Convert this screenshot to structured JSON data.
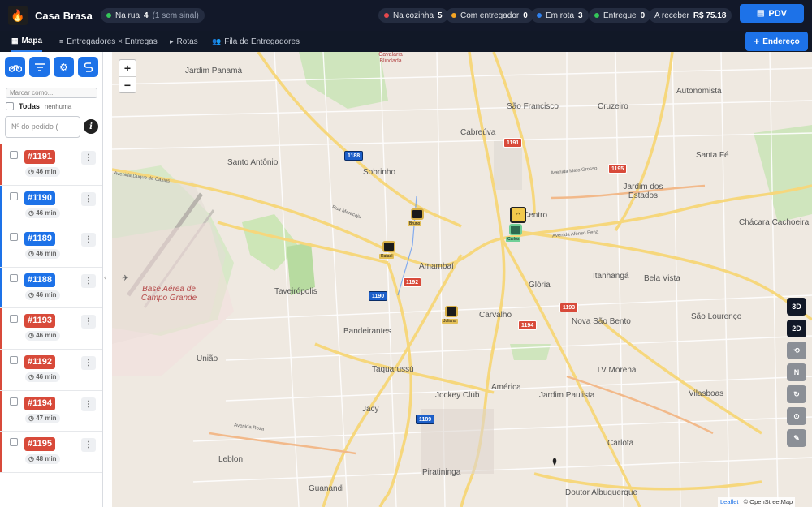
{
  "app": {
    "name": "Casa Brasa",
    "logo_icon": "flame-icon"
  },
  "status": {
    "na_rua": {
      "label": "Na rua",
      "count": "4",
      "sub": "(1 sem sinal)",
      "color": "#34c759"
    },
    "na_cozinha": {
      "label": "Na cozinha",
      "count": "5",
      "color": "#e5484d"
    },
    "com_entregador": {
      "label": "Com entregador",
      "count": "0",
      "color": "#f5a524"
    },
    "em_rota": {
      "label": "Em rota",
      "count": "3",
      "color": "#2f80ed"
    },
    "entregue": {
      "label": "Entregue",
      "count": "0",
      "color": "#34c759"
    },
    "a_receber": {
      "label": "A receber",
      "value": "R$ 75.18"
    }
  },
  "header": {
    "pdv_label": "PDV",
    "endereco_label": "Endereço"
  },
  "tabs": [
    {
      "label": "Mapa",
      "icon": "map-icon"
    },
    {
      "label": "Entregadores × Entregas",
      "icon": "list-icon"
    },
    {
      "label": "Rotas",
      "icon": "route-icon"
    },
    {
      "label": "Fila de Entregadores",
      "icon": "users-icon"
    }
  ],
  "sidebar": {
    "tool_icons": [
      "motorcycle-icon",
      "filter-icon",
      "gear-icon",
      "route-icon"
    ],
    "mark_placeholder": "Marcar como...",
    "todas_label": "Todas",
    "nenhuma_label": "nenhuma",
    "order_placeholder": "Nº do pedido (",
    "info_label": "i",
    "orders": [
      {
        "number": "#1191",
        "time": "46 min",
        "color": "#d84a3a"
      },
      {
        "number": "#1190",
        "time": "46 min",
        "color": "#1d72e8"
      },
      {
        "number": "#1189",
        "time": "46 min",
        "color": "#1d72e8"
      },
      {
        "number": "#1188",
        "time": "46 min",
        "color": "#1d72e8"
      },
      {
        "number": "#1193",
        "time": "46 min",
        "color": "#d84a3a"
      },
      {
        "number": "#1192",
        "time": "46 min",
        "color": "#d84a3a"
      },
      {
        "number": "#1194",
        "time": "47 min",
        "color": "#d84a3a"
      },
      {
        "number": "#1195",
        "time": "48 min",
        "color": "#d84a3a"
      }
    ]
  },
  "map": {
    "zoom_in": "+",
    "zoom_out": "−",
    "neighborhoods": [
      "Jardim Panamá",
      "Santo Antônio",
      "Sobrinho",
      "Cabreúva",
      "São Francisco",
      "Cruzeiro",
      "Autonomista",
      "Santa Fé",
      "Jardim dos Estados",
      "Chácara Cachoeira",
      "Centro",
      "Amambaí",
      "Taveirópolis",
      "Glória",
      "Itanhangá",
      "Bela Vista",
      "São Lourenço",
      "Carvalho",
      "Nova São Bento",
      "Bandeirantes",
      "Taquarussú",
      "União",
      "TV Morena",
      "Jardim Paulista",
      "América",
      "Jockey Club",
      "Vilasboas",
      "Jacy",
      "Carlota",
      "Leblon",
      "Piratininga",
      "Guanandi",
      "Doutor Albuquerque",
      "Cavalaria Blindada"
    ],
    "base_label": "Base Aérea de Campo Grande",
    "roads": [
      "Avenida Duque de Caxias",
      "Avenida Afonso Pena",
      "Avenida Mato Grosso",
      "Rua Maracaju",
      "Avenida Rosa"
    ],
    "order_tags": [
      "1188",
      "1191",
      "1195",
      "1192",
      "1190",
      "1193",
      "1194",
      "1189"
    ],
    "riders": [
      "Bruno",
      "Rafael",
      "Juliana",
      "Carlos"
    ],
    "controls": [
      "3D",
      "2D",
      "⟲",
      "N",
      "↻",
      "⊙",
      "✎"
    ],
    "attribution_leaflet": "Leaflet",
    "attribution_osm": "| © OpenStreetMap"
  }
}
